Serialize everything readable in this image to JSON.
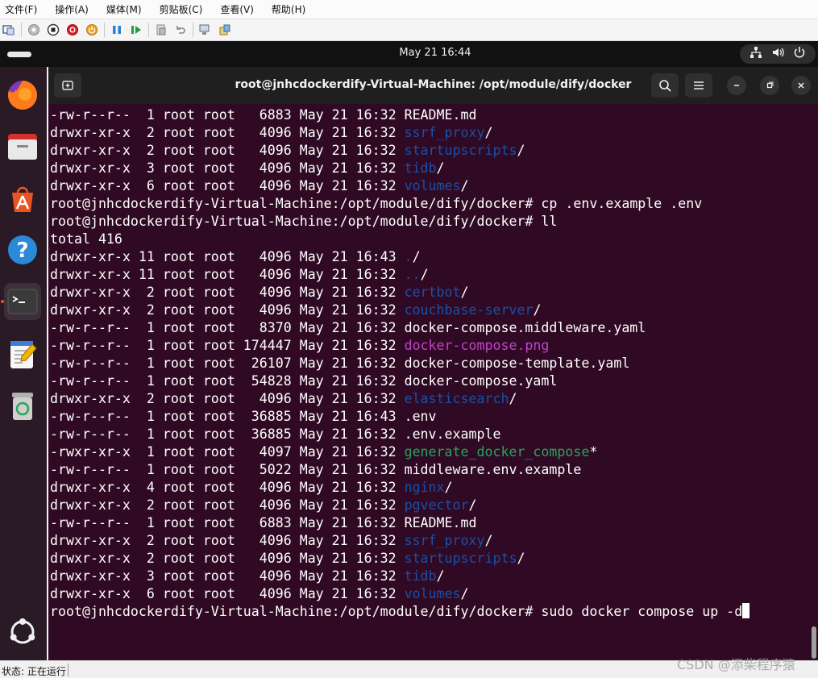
{
  "host": {
    "menus": [
      "文件(F)",
      "操作(A)",
      "媒体(M)",
      "剪贴板(C)",
      "查看(V)",
      "帮助(H)"
    ],
    "status": "状态: 正在运行",
    "watermark": "CSDN @添柴程序猿"
  },
  "topbar": {
    "clock": "May 21  16:44"
  },
  "dock": {
    "items": [
      "firefox-icon",
      "files-icon",
      "app-center-icon",
      "help-icon",
      "terminal-icon",
      "text-editor-icon",
      "trash-icon",
      "show-apps-icon"
    ]
  },
  "terminal": {
    "title": "root@jnhcdockerdify-Virtual-Machine: /opt/module/dify/docker",
    "prompt": "root@jnhcdockerdify-Virtual-Machine:/opt/module/dify/docker# ",
    "lines": [
      {
        "type": "ls",
        "perm": "-rw-r--r--",
        "links": " 1",
        "size": "  6883",
        "date": "May 21 16:32",
        "name": "README.md",
        "kind": "file",
        "suffix": ""
      },
      {
        "type": "ls",
        "perm": "drwxr-xr-x",
        "links": " 2",
        "size": "  4096",
        "date": "May 21 16:32",
        "name": "ssrf_proxy",
        "kind": "dir",
        "suffix": "/"
      },
      {
        "type": "ls",
        "perm": "drwxr-xr-x",
        "links": " 2",
        "size": "  4096",
        "date": "May 21 16:32",
        "name": "startupscripts",
        "kind": "dir",
        "suffix": "/"
      },
      {
        "type": "ls",
        "perm": "drwxr-xr-x",
        "links": " 3",
        "size": "  4096",
        "date": "May 21 16:32",
        "name": "tidb",
        "kind": "dir",
        "suffix": "/"
      },
      {
        "type": "ls",
        "perm": "drwxr-xr-x",
        "links": " 6",
        "size": "  4096",
        "date": "May 21 16:32",
        "name": "volumes",
        "kind": "dir",
        "suffix": "/"
      },
      {
        "type": "cmd",
        "text": "cp .env.example .env"
      },
      {
        "type": "cmd",
        "text": "ll"
      },
      {
        "type": "text",
        "text": "total 416"
      },
      {
        "type": "ls",
        "perm": "drwxr-xr-x",
        "links": "11",
        "size": "  4096",
        "date": "May 21 16:43",
        "name": ".",
        "kind": "dir",
        "suffix": "/"
      },
      {
        "type": "ls",
        "perm": "drwxr-xr-x",
        "links": "11",
        "size": "  4096",
        "date": "May 21 16:32",
        "name": "..",
        "kind": "dir",
        "suffix": "/"
      },
      {
        "type": "ls",
        "perm": "drwxr-xr-x",
        "links": " 2",
        "size": "  4096",
        "date": "May 21 16:32",
        "name": "certbot",
        "kind": "dir",
        "suffix": "/"
      },
      {
        "type": "ls",
        "perm": "drwxr-xr-x",
        "links": " 2",
        "size": "  4096",
        "date": "May 21 16:32",
        "name": "couchbase-server",
        "kind": "dir",
        "suffix": "/"
      },
      {
        "type": "ls",
        "perm": "-rw-r--r--",
        "links": " 1",
        "size": "  8370",
        "date": "May 21 16:32",
        "name": "docker-compose.middleware.yaml",
        "kind": "file",
        "suffix": ""
      },
      {
        "type": "ls",
        "perm": "-rw-r--r--",
        "links": " 1",
        "size": "174447",
        "date": "May 21 16:32",
        "name": "docker-compose.png",
        "kind": "img",
        "suffix": ""
      },
      {
        "type": "ls",
        "perm": "-rw-r--r--",
        "links": " 1",
        "size": " 26107",
        "date": "May 21 16:32",
        "name": "docker-compose-template.yaml",
        "kind": "file",
        "suffix": ""
      },
      {
        "type": "ls",
        "perm": "-rw-r--r--",
        "links": " 1",
        "size": " 54828",
        "date": "May 21 16:32",
        "name": "docker-compose.yaml",
        "kind": "file",
        "suffix": ""
      },
      {
        "type": "ls",
        "perm": "drwxr-xr-x",
        "links": " 2",
        "size": "  4096",
        "date": "May 21 16:32",
        "name": "elasticsearch",
        "kind": "dir",
        "suffix": "/"
      },
      {
        "type": "ls",
        "perm": "-rw-r--r--",
        "links": " 1",
        "size": " 36885",
        "date": "May 21 16:43",
        "name": ".env",
        "kind": "file",
        "suffix": ""
      },
      {
        "type": "ls",
        "perm": "-rw-r--r--",
        "links": " 1",
        "size": " 36885",
        "date": "May 21 16:32",
        "name": ".env.example",
        "kind": "file",
        "suffix": ""
      },
      {
        "type": "ls",
        "perm": "-rwxr-xr-x",
        "links": " 1",
        "size": "  4097",
        "date": "May 21 16:32",
        "name": "generate_docker_compose",
        "kind": "exe",
        "suffix": "*"
      },
      {
        "type": "ls",
        "perm": "-rw-r--r--",
        "links": " 1",
        "size": "  5022",
        "date": "May 21 16:32",
        "name": "middleware.env.example",
        "kind": "file",
        "suffix": ""
      },
      {
        "type": "ls",
        "perm": "drwxr-xr-x",
        "links": " 4",
        "size": "  4096",
        "date": "May 21 16:32",
        "name": "nginx",
        "kind": "dir",
        "suffix": "/"
      },
      {
        "type": "ls",
        "perm": "drwxr-xr-x",
        "links": " 2",
        "size": "  4096",
        "date": "May 21 16:32",
        "name": "pgvector",
        "kind": "dir",
        "suffix": "/"
      },
      {
        "type": "ls",
        "perm": "-rw-r--r--",
        "links": " 1",
        "size": "  6883",
        "date": "May 21 16:32",
        "name": "README.md",
        "kind": "file",
        "suffix": ""
      },
      {
        "type": "ls",
        "perm": "drwxr-xr-x",
        "links": " 2",
        "size": "  4096",
        "date": "May 21 16:32",
        "name": "ssrf_proxy",
        "kind": "dir",
        "suffix": "/"
      },
      {
        "type": "ls",
        "perm": "drwxr-xr-x",
        "links": " 2",
        "size": "  4096",
        "date": "May 21 16:32",
        "name": "startupscripts",
        "kind": "dir",
        "suffix": "/"
      },
      {
        "type": "ls",
        "perm": "drwxr-xr-x",
        "links": " 3",
        "size": "  4096",
        "date": "May 21 16:32",
        "name": "tidb",
        "kind": "dir",
        "suffix": "/"
      },
      {
        "type": "ls",
        "perm": "drwxr-xr-x",
        "links": " 6",
        "size": "  4096",
        "date": "May 21 16:32",
        "name": "volumes",
        "kind": "dir",
        "suffix": "/"
      },
      {
        "type": "input",
        "text": "sudo docker compose up -d"
      }
    ],
    "owner": "root root"
  },
  "colors": {
    "terminal_bg": "#300a24",
    "dir": "#1a50a6",
    "image": "#c042c9",
    "executable": "#28a35a",
    "ubuntu_orange": "#e95420"
  }
}
